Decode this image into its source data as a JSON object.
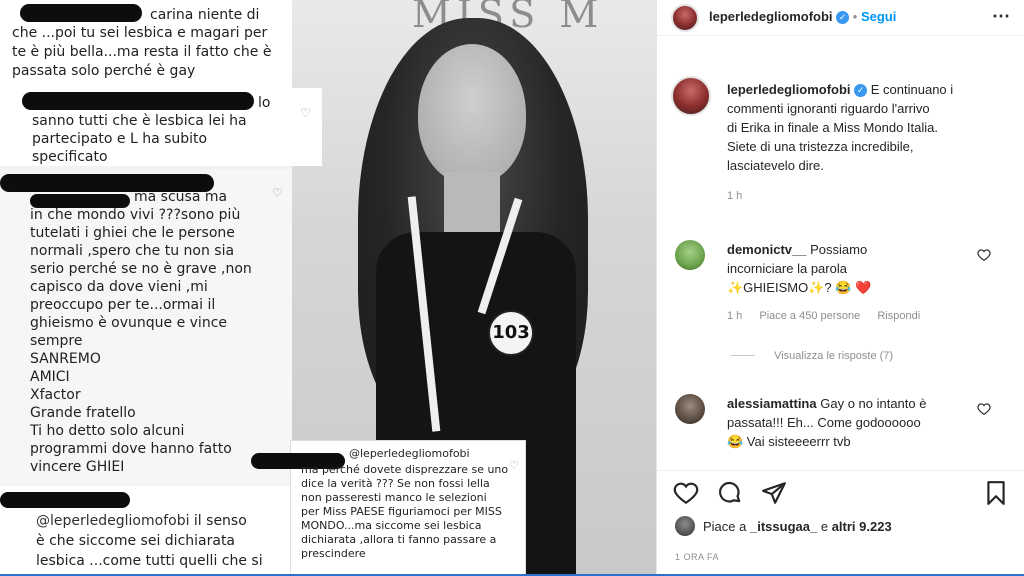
{
  "collage": {
    "banner": "MISS M",
    "badge_number": "103",
    "card1": {
      "lines": [
        "carina niente di",
        "che ...poi tu sei lesbica e magari per",
        "te è più bella...ma resta il fatto che è",
        "passata solo perché è gay"
      ]
    },
    "card2": {
      "suffix": "lo",
      "lines": [
        "sanno tutti che è lesbica lei ha",
        "partecipato e L ha subito",
        "specificato"
      ]
    },
    "card3": {
      "lines": [
        "ma scusa ma",
        "in che mondo vivi ???sono più",
        "tutelati i ghiei che le persone",
        "normali ,spero che tu non sia",
        "serio perché se no è grave ,non",
        "capisco da dove vieni ,mi",
        "preoccupo per te...ormai il",
        "ghieismo è ovunque e vince",
        "sempre",
        "SANREMO",
        "AMICI",
        "Xfactor",
        "Grande fratello",
        "Ti ho detto solo alcuni",
        "programmi dove hanno fatto",
        "vincere GHIEI"
      ]
    },
    "card4": {
      "handle": "@leperledegliomofobi",
      "lines": [
        "il senso",
        "è che siccome sei dichiarata",
        "lesbica ...come tutti quelli che si"
      ]
    },
    "card5": {
      "handle": "@leperledegliomofobi",
      "lines": [
        "ma perché dovete disprezzare se uno",
        "dice la verità ??? Se non fossi lella",
        "non passeresti manco le selezioni",
        "per Miss PAESE figuriamoci per MISS",
        "MONDO...ma siccome sei lesbica",
        "dichiarata ,allora ti fanno passare a",
        "prescindere"
      ]
    }
  },
  "instagram": {
    "header": {
      "username": "leperledegliomofobi",
      "separator": "•",
      "follow_label": "Segui",
      "more_icon": "more-dots-icon"
    },
    "caption": {
      "username": "leperledegliomofobi",
      "text_lines": [
        "E continuano i",
        "commenti ignoranti riguardo l'arrivo",
        "di Erika in finale a Miss Mondo Italia.",
        "Siete di una tristezza incredibile,",
        "lasciatevelo dire."
      ],
      "time": "1 h"
    },
    "comments": [
      {
        "username": "demonictv__",
        "text_lines": [
          "Possiamo",
          "incorniciare la parola",
          "✨GHIEISMO✨? 😂 ❤️"
        ],
        "time": "1 h",
        "likes": "Piace a 450 persone",
        "reply": "Rispondi",
        "view_replies": "Visualizza le risposte (7)"
      },
      {
        "username": "alessiamattina",
        "text_lines": [
          "Gay o no intanto è",
          "passata!!! Eh... Come godoooooo",
          "😂 Vai sisteeeerrr tvb"
        ]
      }
    ],
    "likes": {
      "prefix": "Piace a",
      "user": "_itssugaa_",
      "middle": "e",
      "others": "altri 9.223"
    },
    "timestamp": "1 ORA FA",
    "colors": {
      "link_blue": "#0095f6",
      "verified_blue": "#3897f0",
      "heart_red": "#ed4956"
    }
  }
}
